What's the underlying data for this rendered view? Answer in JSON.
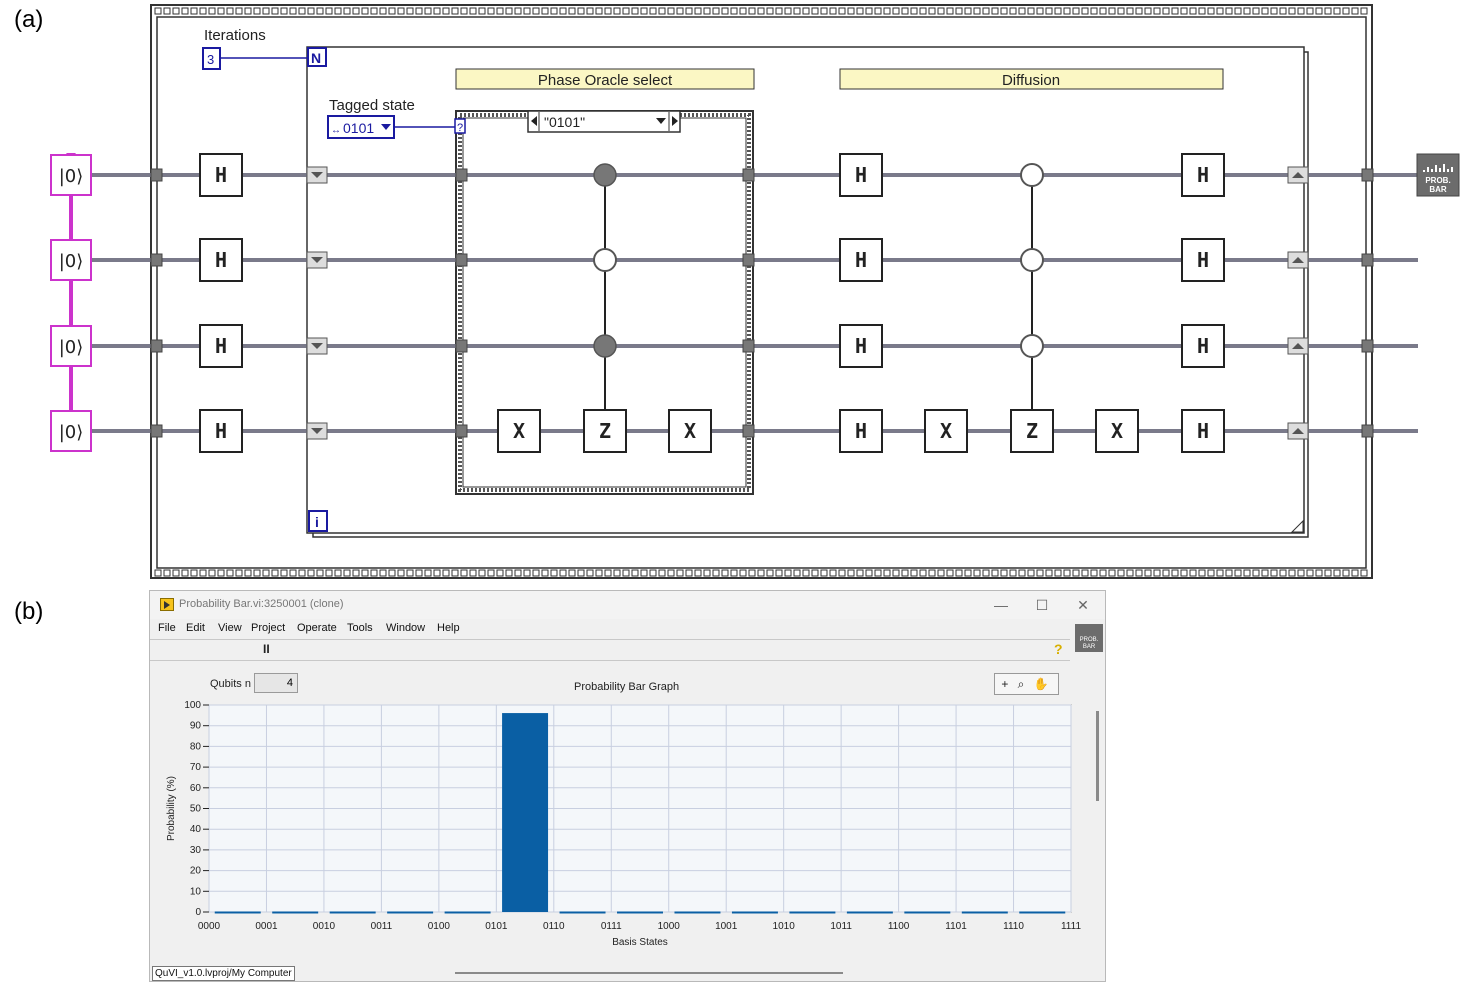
{
  "panel_labels": {
    "a": "(a)",
    "b": "(b)"
  },
  "diagram": {
    "iterations_label": "Iterations",
    "iterations_value": "3",
    "loop_count_terminal": "N",
    "loop_index_terminal": "i",
    "tagged_state_label": "Tagged state",
    "tagged_state_value": "0101",
    "case_selector_value": "\"0101\"",
    "case_selector_terminal": "?",
    "oracle_label": "Phase Oracle select",
    "diffusion_label": "Diffusion",
    "qubit_init_label": "|0⟩",
    "gates": {
      "h": "H",
      "x": "X",
      "z": "Z"
    },
    "output_icon_label": "PROB. BAR",
    "colors": {
      "wire": "#7a7a8a",
      "init": "#cc33cc",
      "frame": "#1a1aa0",
      "label_bg": "#fbf7c4",
      "control": "#777777"
    }
  },
  "window": {
    "title": "Probability Bar.vi:3250001 (clone)",
    "menu": [
      "File",
      "Edit",
      "View",
      "Project",
      "Operate",
      "Tools",
      "Window",
      "Help"
    ],
    "controls": {
      "minimize": "—",
      "maximize": "☐",
      "close": "✕"
    },
    "pause_glyph": "II",
    "help_glyph": "?",
    "qubits_label": "Qubits n",
    "qubits_value": "4",
    "palette_icons": "+ ⌕ ✋",
    "status_bar": "QuVI_v1.0.lvproj/My Computer",
    "prob_icon_label": "PROB. BAR"
  },
  "chart_data": {
    "type": "bar",
    "title": "Probability Bar Graph",
    "xlabel": "Basis States",
    "ylabel": "Probability (%)",
    "ylim": [
      0,
      100
    ],
    "yticks": [
      0,
      10,
      20,
      30,
      40,
      50,
      60,
      70,
      80,
      90,
      100
    ],
    "categories": [
      "0000",
      "0001",
      "0010",
      "0011",
      "0100",
      "0101",
      "0110",
      "0111",
      "1000",
      "1001",
      "1010",
      "1011",
      "1100",
      "1101",
      "1110",
      "1111"
    ],
    "values": [
      0.25,
      0.25,
      0.25,
      0.25,
      0.25,
      96.1,
      0.25,
      0.25,
      0.25,
      0.25,
      0.25,
      0.25,
      0.25,
      0.25,
      0.25,
      0.25
    ],
    "grid": true,
    "bar_color": "#0a5fa4"
  }
}
